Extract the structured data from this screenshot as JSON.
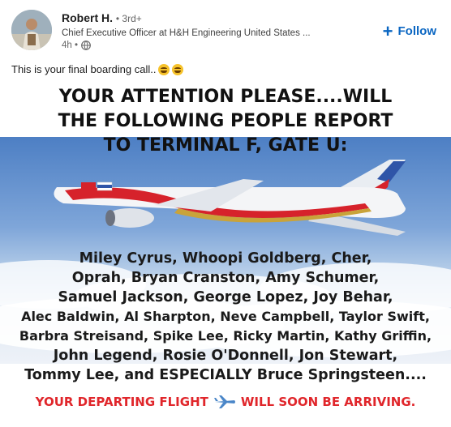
{
  "author": {
    "name": "Robert H.",
    "degree": "• 3rd+",
    "headline": "Chief Executive Officer at H&H Engineering United States ...",
    "time": "4h •"
  },
  "follow_label": "Follow",
  "post_text": "This is your final boarding call..",
  "meme": {
    "title_lines": [
      "YOUR ATTENTION PLEASE....WILL",
      "THE FOLLOWING PEOPLE REPORT",
      "TO TERMINAL F, GATE U:"
    ],
    "names_lines": [
      "Miley Cyrus, Whoopi Goldberg, Cher,",
      "Oprah, Bryan Cranston, Amy Schumer,",
      "Samuel Jackson, George Lopez, Joy Behar,",
      "Alec Baldwin, Al Sharpton, Neve Campbell, Taylor Swift,",
      "Barbra Streisand, Spike Lee, Ricky Martin, Kathy Griffin,",
      "John Legend, Rosie O'Donnell, Jon Stewart,",
      "Tommy Lee, and ESPECIALLY Bruce Springsteen...."
    ],
    "bottom_left": "YOUR DEPARTING FLIGHT",
    "bottom_right": "WILL SOON BE ARRIVING."
  },
  "icons": [
    "globe-icon",
    "plus-icon",
    "laughing-emoji-icon",
    "airplane-icon"
  ],
  "colors": {
    "follow": "#0a66c2",
    "bottom_text": "#e0262b"
  }
}
